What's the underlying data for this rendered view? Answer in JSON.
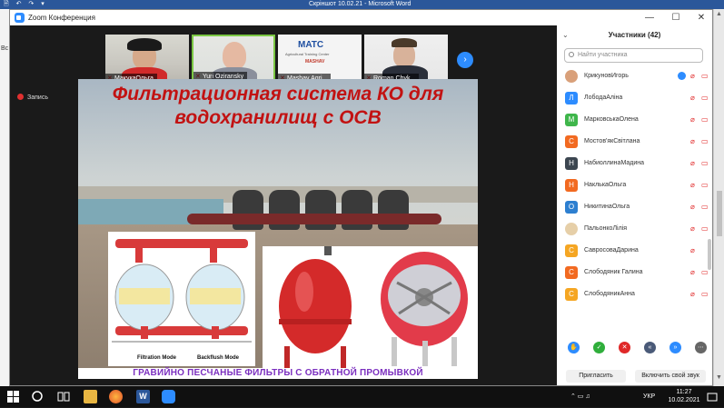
{
  "word": {
    "title": "Скріншот 10.02.21  -  Microsoft Word",
    "quick_access": "🗎 ↶ ↷ ▾",
    "ribbon_letter": "Вс"
  },
  "zoom": {
    "window_title": "Zoom Конференция",
    "min": "—",
    "max": "☐",
    "close": "✕",
    "recording": "Запись",
    "next_arrow": "›",
    "videos": [
      {
        "name": "МакукаОльга"
      },
      {
        "name": "Yuri Oziransky"
      },
      {
        "name": "Mashav Agri..."
      },
      {
        "name": "Roman Chyk..."
      }
    ],
    "slide": {
      "title_line1": "Фильтрационная система КО для",
      "title_line2": "водохранилищ с ОСВ",
      "filtration_mode": "Filtration Mode",
      "backflush_mode": "Backflush Mode",
      "caption": "ГРАВИЙНО ПЕСЧАНЫЕ ФИЛЬТРЫ С ОБРАТНОЙ ПРОМЫВКОЙ",
      "logo_text": "MATC",
      "logo_sub": "Agricultural Training Center",
      "logo_brand": "MASHAV"
    }
  },
  "participants": {
    "title": "Участники (42)",
    "expand_icon": "⌄",
    "search_placeholder": "Найти участника",
    "list": [
      {
        "name": "КрикуновИгорь",
        "initial": "",
        "color": "#d9a07a",
        "avatar": "photo",
        "hand": true,
        "mic_muted": true,
        "cam_off": true
      },
      {
        "name": "ЛободаАліна",
        "initial": "Л",
        "color": "#2d8cff",
        "mic_muted": true,
        "cam_off": true
      },
      {
        "name": "МарковськаОлена",
        "initial": "М",
        "color": "#3fb64b",
        "mic_muted": true,
        "cam_off": false
      },
      {
        "name": "Мостов'якСвітлана",
        "initial": "С",
        "color": "#f26a21",
        "mic_muted": true,
        "cam_off": false
      },
      {
        "name": "НабиоллинаМадина",
        "initial": "Н",
        "color": "#3c4650",
        "mic_muted": true,
        "cam_off": true
      },
      {
        "name": "НаклькаОльга",
        "initial": "Н",
        "color": "#f26a21",
        "mic_muted": true,
        "cam_off": true
      },
      {
        "name": "НикитинаОльга",
        "initial": "О",
        "color": "#2d7fd0",
        "mic_muted": true,
        "cam_off": true
      },
      {
        "name": "ПальонкоЛілія",
        "initial": "",
        "color": "#e6cfa8",
        "avatar": "photo",
        "mic_muted": true,
        "cam_off": true
      },
      {
        "name": "СавросоваДарина",
        "initial": "С",
        "color": "#f5a623",
        "mic_muted": true,
        "cam_off": false
      },
      {
        "name": "Слободяник Галина",
        "initial": "С",
        "color": "#f26a21",
        "mic_muted": true,
        "cam_off": true
      },
      {
        "name": "СлободяникАнна",
        "initial": "С",
        "color": "#f5a623",
        "mic_muted": true,
        "cam_off": true
      }
    ],
    "invite_label": "Пригласить",
    "unmute_label": "Включить свой звук"
  },
  "taskbar": {
    "lang": "УКР",
    "time": "11:27",
    "date": "10.02.2021",
    "tray_icons": "⌃ ▭ ♫"
  },
  "colors": {
    "zoom_blue": "#2d8cff",
    "word_blue": "#2b579a",
    "muted_red": "#e02828",
    "slide_title": "#c21212",
    "caption_purple": "#7b2fbf"
  }
}
